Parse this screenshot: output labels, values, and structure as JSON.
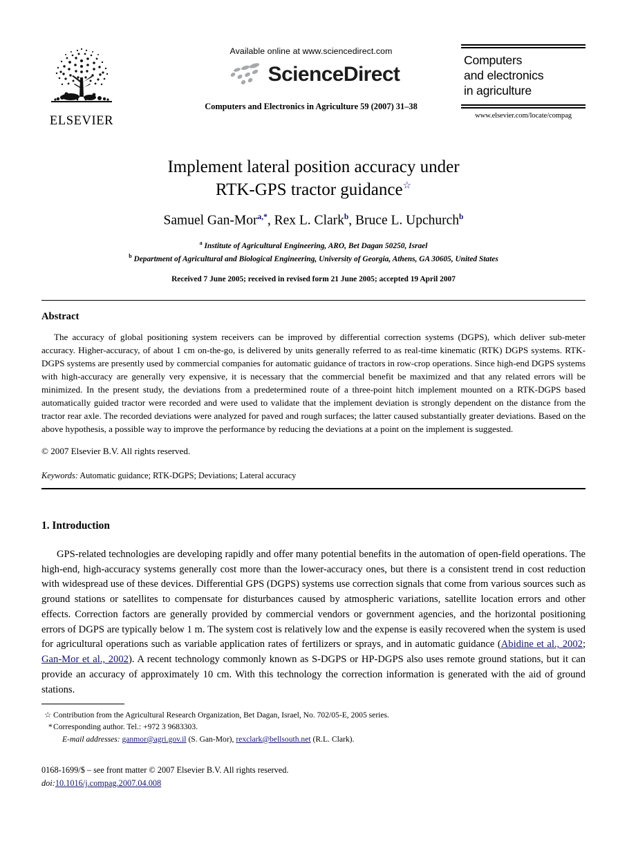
{
  "masthead": {
    "publisher_name": "ELSEVIER",
    "available_online": "Available online at www.sciencedirect.com",
    "sciencedirect_wordmark": "ScienceDirect",
    "journal_citation": "Computers and Electronics in Agriculture 59 (2007) 31–38",
    "cover_title_line1": "Computers",
    "cover_title_line2": "and electronics",
    "cover_title_line3": "in agriculture",
    "cover_url": "www.elsevier.com/locate/compag"
  },
  "title": {
    "line1": "Implement lateral position accuracy under",
    "line2": "RTK-GPS tractor guidance",
    "footnote_symbol": "☆"
  },
  "authors": {
    "author1_name": "Samuel Gan-Mor",
    "author1_marks": "a,*",
    "sep1": ", ",
    "author2_name": "Rex L. Clark",
    "author2_marks": "b",
    "sep2": ", ",
    "author3_name": "Bruce L. Upchurch",
    "author3_marks": "b"
  },
  "affiliations": {
    "a_mark": "a",
    "a_text": "Institute of Agricultural Engineering, ARO, Bet Dagan 50250, Israel",
    "b_mark": "b",
    "b_text": "Department of Agricultural and Biological Engineering, University of Georgia, Athens, GA 30605, United States",
    "received": "Received 7 June 2005; received in revised form 21 June 2005; accepted 19 April 2007"
  },
  "abstract": {
    "heading": "Abstract",
    "body": "The accuracy of global positioning system receivers can be improved by differential correction systems (DGPS), which deliver sub-meter accuracy. Higher-accuracy, of about 1 cm on-the-go, is delivered by units generally referred to as real-time kinematic (RTK) DGPS systems. RTK-DGPS systems are presently used by commercial companies for automatic guidance of tractors in row-crop operations. Since high-end DGPS systems with high-accuracy are generally very expensive, it is necessary that the commercial benefit be maximized and that any related errors will be minimized. In the present study, the deviations from a predetermined route of a three-point hitch implement mounted on a RTK-DGPS based automatically guided tractor were recorded and were used to validate that the implement deviation is strongly dependent on the distance from the tractor rear axle. The recorded deviations were analyzed for paved and rough surfaces; the latter caused substantially greater deviations. Based on the above hypothesis, a possible way to improve the performance by reducing the deviations at a point on the implement is suggested.",
    "copyright": "© 2007 Elsevier B.V. All rights reserved.",
    "keywords_label": "Keywords:",
    "keywords_value": "Automatic guidance; RTK-DGPS; Deviations; Lateral accuracy"
  },
  "introduction": {
    "heading": "1. Introduction",
    "para_part1": "GPS-related technologies are developing rapidly and offer many potential benefits in the automation of open-field operations. The high-end, high-accuracy systems generally cost more than the lower-accuracy ones, but there is a consistent trend in cost reduction with widespread use of these devices. Differential GPS (DGPS) systems use correction signals that come from various sources such as ground stations or satellites to compensate for disturbances caused by atmospheric variations, satellite location errors and other effects. Correction factors are generally provided by commercial vendors or government agencies, and the horizontal positioning errors of DGPS are typically below 1 m. The system cost is relatively low and the expense is easily recovered when the system is used for agricultural operations such as variable application rates of fertilizers or sprays, and in automatic guidance (",
    "citation1": "Abidine et al., 2002",
    "cite_sep": "; ",
    "citation2": "Gan-Mor et al., 2002",
    "para_part2": "). A recent technology commonly known as S-DGPS or HP-DGPS also uses remote ground stations, but it can provide an accuracy of approximately 10 cm. With this technology the correction information is generated with the aid of ground stations."
  },
  "footnotes": {
    "star_symbol": "☆",
    "star_text": "Contribution from the Agricultural Research Organization, Bet Dagan, Israel, No. 702/05-E, 2005 series.",
    "asterisk_symbol": "*",
    "asterisk_text": "Corresponding author. Tel.: +972 3 9683303.",
    "email_label": "E-mail addresses:",
    "email1": "ganmor@agri.gov.il",
    "email1_owner": "(S. Gan-Mor),",
    "email2": "rexclark@bellsouth.net",
    "email2_owner": "(R.L. Clark)."
  },
  "imprint": {
    "issn_line": "0168-1699/$ – see front matter © 2007 Elsevier B.V. All rights reserved.",
    "doi_label": "doi:",
    "doi_value": "10.1016/j.compag.2007.04.008"
  },
  "colors": {
    "link": "#14146e",
    "text": "#000000",
    "background": "#ffffff"
  }
}
